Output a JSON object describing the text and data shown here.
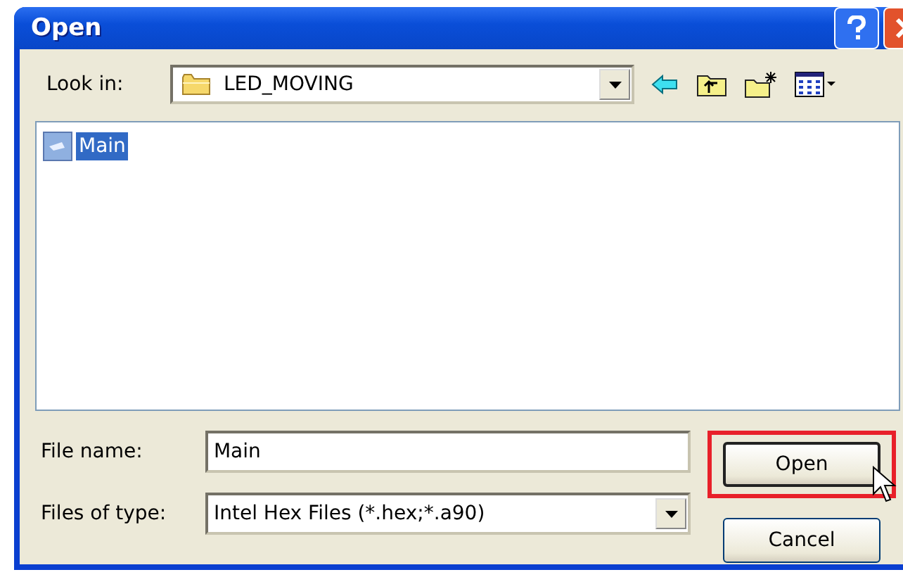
{
  "window": {
    "title": "Open"
  },
  "look_in": {
    "label": "Look in:",
    "value": "LED_MOVING"
  },
  "files": [
    {
      "name": "Main",
      "selected": true
    }
  ],
  "file_name": {
    "label": "File name:",
    "value": "Main"
  },
  "files_of_type": {
    "label": "Files of type:",
    "value": "Intel Hex Files (*.hex;*.a90)"
  },
  "buttons": [
    {
      "label": "Open",
      "highlighted": true
    },
    {
      "label": "Cancel",
      "highlighted": false
    }
  ]
}
